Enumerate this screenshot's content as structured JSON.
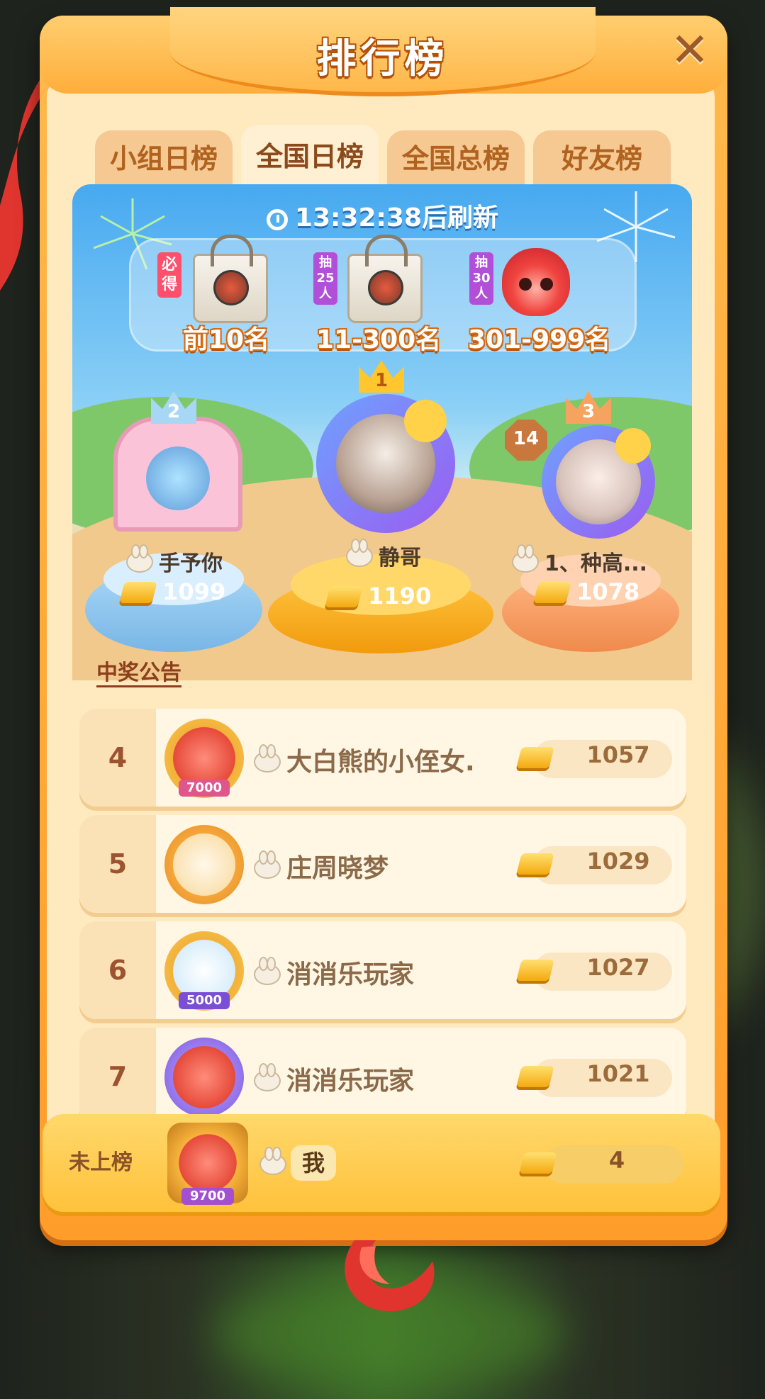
{
  "title": "排行榜",
  "close_icon": "close-icon",
  "tabs": [
    {
      "label": "小组日榜",
      "active": false
    },
    {
      "label": "全国日榜",
      "active": true
    },
    {
      "label": "全国总榜",
      "active": false
    },
    {
      "label": "好友榜",
      "active": false
    }
  ],
  "refresh": {
    "time": "13:32:38",
    "suffix": "后刷新"
  },
  "prizes": [
    {
      "tag": "必得",
      "label": "前10名",
      "icon": "gift-bag-icon"
    },
    {
      "tag": "抽25人",
      "label": "11-300名",
      "icon": "gift-bag-icon"
    },
    {
      "tag": "抽30人",
      "label": "301-999名",
      "icon": "red-fox-plush-icon"
    }
  ],
  "podium": [
    {
      "rank": "2",
      "name": "手予你",
      "score": "1099"
    },
    {
      "rank": "1",
      "name": "静哥",
      "score": "1190"
    },
    {
      "rank": "3",
      "name": "1、种高...",
      "score": "1078",
      "level": "14"
    }
  ],
  "announcement": "中奖公告",
  "list": [
    {
      "rank": "4",
      "name": "大白熊的小侄女.",
      "score": "1057",
      "frame_badge": "7000"
    },
    {
      "rank": "5",
      "name": "庄周晓梦",
      "score": "1029"
    },
    {
      "rank": "6",
      "name": "消消乐玩家",
      "score": "1027",
      "frame_badge": "5000"
    },
    {
      "rank": "7",
      "name": "消消乐玩家",
      "score": "1021"
    }
  ],
  "me": {
    "rank": "未上榜",
    "name": "我",
    "score": "4",
    "frame_badge": "9700"
  },
  "colors": {
    "frame": "#ff9d2a",
    "panel": "#ffe9bf",
    "gold": "#f4a90f",
    "rank_text": "#9b5330"
  }
}
